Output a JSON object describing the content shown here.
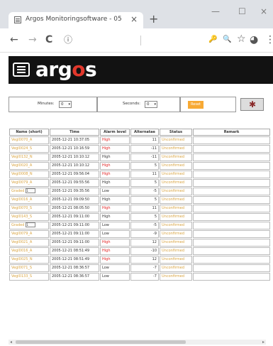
{
  "browser": {
    "tab_title": "Argos Monitoringsoftware - 05",
    "tab_close": "×",
    "new_tab": "+",
    "minimize": "—",
    "maximize": "☐",
    "close": "×",
    "back": "←",
    "forward": "→",
    "reload": "C",
    "info": "ⓘ",
    "key": "🔑",
    "zoom": "🔍",
    "star": "☆",
    "profile": "◕",
    "menu": "⋮"
  },
  "app": {
    "logo_prefix": "arg",
    "logo_accent": "o",
    "logo_suffix": "s",
    "accent_color": "#e2382c"
  },
  "filters": {
    "minutes_label": "Minutes:",
    "minutes_value": "0",
    "seconds_label": "Seconds:",
    "seconds_value": "0",
    "reset_label": "Reset",
    "icon": "bug-icon"
  },
  "table": {
    "headers": [
      "Name (short)",
      "Time",
      "Alarm level",
      "Alternatae",
      "Status",
      "Remark"
    ],
    "rows": [
      {
        "name": "Vegl0070_A",
        "time": "2005-12-21 10:37:05",
        "level": "High",
        "value": "11",
        "status": "Unconfirmed",
        "color": "red"
      },
      {
        "name": "Vegl0024_S",
        "time": "2005-12-21 10:16:59",
        "level": "High",
        "value": "-11",
        "status": "Unconfirmed",
        "color": "red"
      },
      {
        "name": "Vegl0132_N",
        "time": "2005-12-21 10:10:12",
        "level": "High",
        "value": "-11",
        "status": "Unconfirmed",
        "color": "yellow"
      },
      {
        "name": "Vegl0020_A",
        "time": "2005-12-21 10:10:12",
        "level": "High",
        "value": "5",
        "status": "Unconfirmed",
        "color": "red"
      },
      {
        "name": "Vegl0008_N",
        "time": "2005-12-21 09:56:04",
        "level": "High",
        "value": "11",
        "status": "Unconfirmed",
        "color": "red"
      },
      {
        "name": "Vegl0079_A",
        "time": "2005-12-21 09:55:56",
        "level": "High",
        "value": "5",
        "status": "Unconfirmed",
        "color": "yellow"
      },
      {
        "name": "Graded",
        "time": "2005-12-21 09:35:56",
        "level": "Low",
        "value": "-5",
        "status": "Unconfirmed",
        "color": "yellow",
        "select": "1"
      },
      {
        "name": "Vegl0016_A",
        "time": "2005-12-21 09:09:50",
        "level": "High",
        "value": "5",
        "status": "Unconfirmed",
        "color": "yellow"
      },
      {
        "name": "Vegl0070_S",
        "time": "2005-12-21 08:05:50",
        "level": "High",
        "value": "11",
        "status": "Unconfirmed",
        "color": "red"
      },
      {
        "name": "Vegl0143_S",
        "time": "2005-12-21 09:11:00",
        "level": "High",
        "value": "5",
        "status": "Unconfirmed",
        "color": "yellow"
      },
      {
        "name": "Graded",
        "time": "2005-12-21 09:11:00",
        "level": "Low",
        "value": "-5",
        "status": "Unconfirmed",
        "color": "yellow",
        "select": "1"
      },
      {
        "name": "Vegl0079_A",
        "time": "2005-12-21 09:11:00",
        "level": "Low",
        "value": "-9",
        "status": "Unconfirmed",
        "color": "yellow"
      },
      {
        "name": "Vegl0021_A",
        "time": "2005-12-21 09:11:00",
        "level": "High",
        "value": "12",
        "status": "Unconfirmed",
        "color": "red"
      },
      {
        "name": "Vegl0016_A",
        "time": "2005-12-21 08:51:49",
        "level": "High",
        "value": "-10",
        "status": "Unconfirmed",
        "color": "red"
      },
      {
        "name": "Vegl0025_N",
        "time": "2005-12-21 08:51:49",
        "level": "High",
        "value": "12",
        "status": "Unconfirmed",
        "color": "red"
      },
      {
        "name": "Vegl0071_S",
        "time": "2005-12-21 08:36:57",
        "level": "Low",
        "value": "-7",
        "status": "Unconfirmed",
        "color": "yellow"
      },
      {
        "name": "Vegl0133_S",
        "time": "2005-12-21 08:36:57",
        "level": "Low",
        "value": "-7",
        "status": "Unconfirmed",
        "color": "yellow"
      }
    ]
  }
}
